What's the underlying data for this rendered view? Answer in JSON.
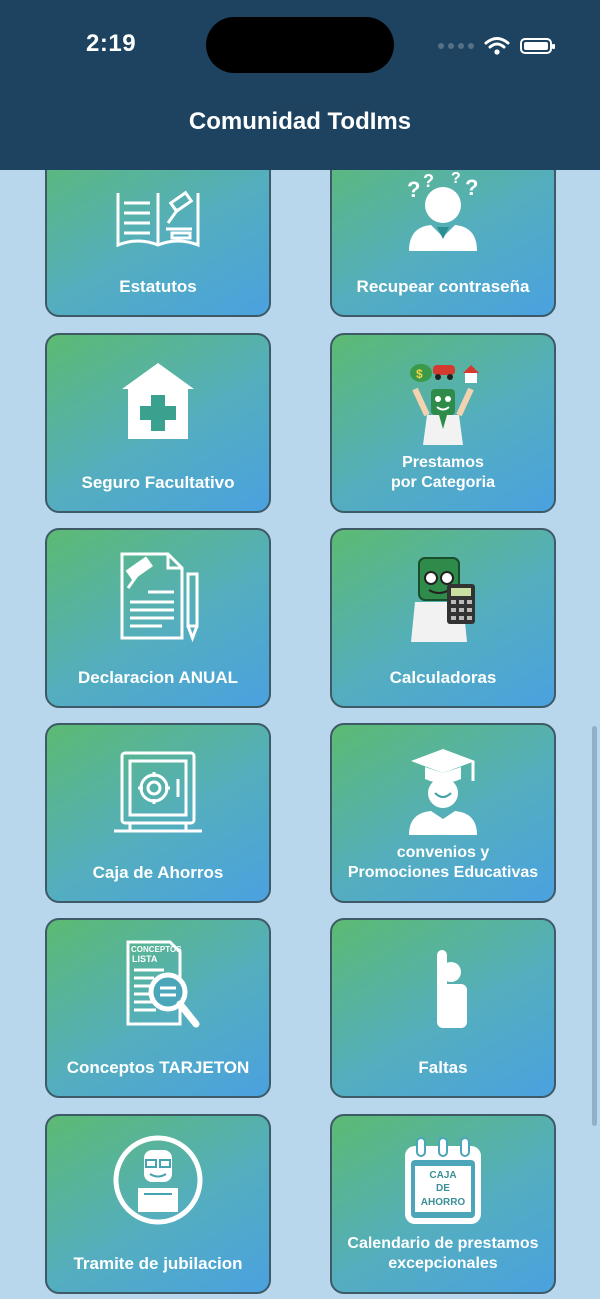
{
  "status_bar": {
    "time": "2:19"
  },
  "header": {
    "title": "Comunidad TodIms"
  },
  "menu": [
    {
      "label": "Estatutos",
      "icon": "law-book-icon"
    },
    {
      "label": "Recupear contraseña",
      "icon": "forgot-password-icon"
    },
    {
      "label": "Seguro Facultativo",
      "icon": "medical-house-icon"
    },
    {
      "label": "Prestamos\npor Categoria",
      "icon": "loans-mascot-icon"
    },
    {
      "label": "Declaracion ANUAL",
      "icon": "legal-document-icon"
    },
    {
      "label": "Calculadoras",
      "icon": "calculator-mascot-icon"
    },
    {
      "label": "Caja de Ahorros",
      "icon": "safe-icon"
    },
    {
      "label": "convenios y\nPromociones Educativas",
      "icon": "graduate-icon"
    },
    {
      "label": "Conceptos TARJETON",
      "icon": "concept-list-search-icon"
    },
    {
      "label": "Faltas",
      "icon": "raised-hand-icon"
    },
    {
      "label": "Tramite de jubilacion",
      "icon": "retiree-icon"
    },
    {
      "label": "Calendario de prestamos\nexcepcionales",
      "icon": "calendar-icon"
    }
  ],
  "icon_texts": {
    "conceptos_top": "CONCEPTOS",
    "conceptos_bottom": "LISTA",
    "calendar_line1": "CAJA",
    "calendar_line2": "DE",
    "calendar_line3": "AHORRO"
  }
}
